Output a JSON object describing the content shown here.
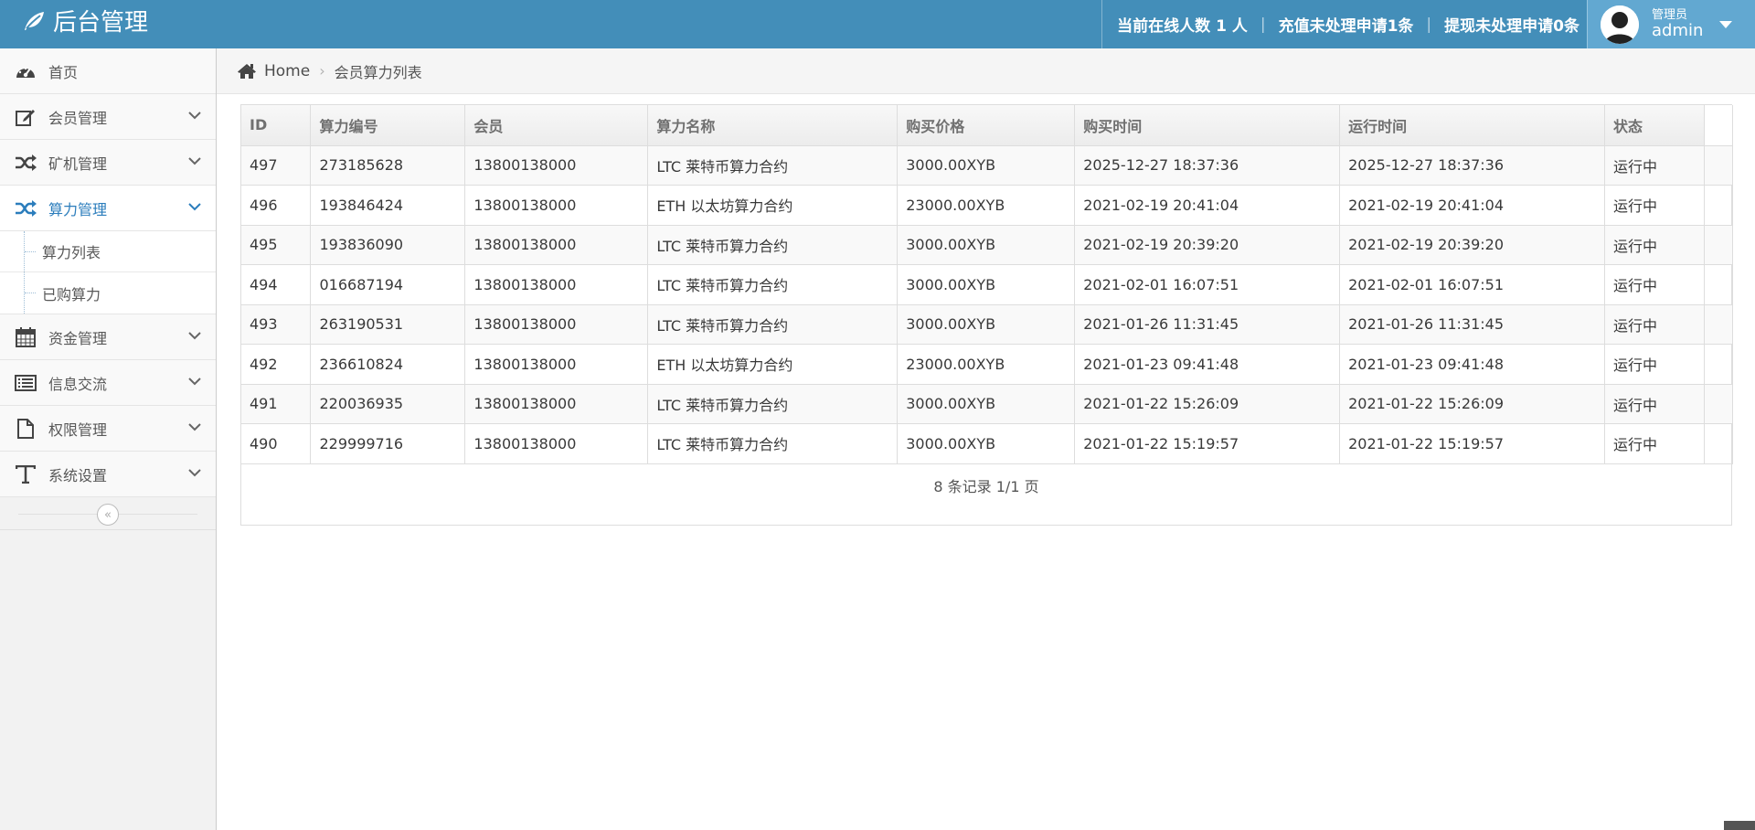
{
  "header": {
    "brand": "后台管理",
    "online_users": "当前在线人数 1 人",
    "recharge_pending": "充值未处理申请1条",
    "withdraw_pending": "提现未处理申请0条",
    "user_role": "管理员",
    "user_name": "admin"
  },
  "sidebar": {
    "items": [
      {
        "label": "首页"
      },
      {
        "label": "会员管理"
      },
      {
        "label": "矿机管理"
      },
      {
        "label": "算力管理"
      },
      {
        "label": "资金管理"
      },
      {
        "label": "信息交流"
      },
      {
        "label": "权限管理"
      },
      {
        "label": "系统设置"
      }
    ],
    "submenu": [
      {
        "label": "算力列表"
      },
      {
        "label": "已购算力"
      }
    ],
    "collapse_glyph": "«"
  },
  "breadcrumb": {
    "home": "Home",
    "current": "会员算力列表"
  },
  "table": {
    "headers": [
      "ID",
      "算力编号",
      "会员",
      "算力名称",
      "购买价格",
      "购买时间",
      "运行时间",
      "状态"
    ],
    "rows": [
      [
        "497",
        "273185628",
        "13800138000",
        "LTC 莱特币算力合约",
        "3000.00XYB",
        "2025-12-27 18:37:36",
        "2025-12-27 18:37:36",
        "运行中"
      ],
      [
        "496",
        "193846424",
        "13800138000",
        "ETH 以太坊算力合约",
        "23000.00XYB",
        "2021-02-19 20:41:04",
        "2021-02-19 20:41:04",
        "运行中"
      ],
      [
        "495",
        "193836090",
        "13800138000",
        "LTC 莱特币算力合约",
        "3000.00XYB",
        "2021-02-19 20:39:20",
        "2021-02-19 20:39:20",
        "运行中"
      ],
      [
        "494",
        "016687194",
        "13800138000",
        "LTC 莱特币算力合约",
        "3000.00XYB",
        "2021-02-01 16:07:51",
        "2021-02-01 16:07:51",
        "运行中"
      ],
      [
        "493",
        "263190531",
        "13800138000",
        "LTC 莱特币算力合约",
        "3000.00XYB",
        "2021-01-26 11:31:45",
        "2021-01-26 11:31:45",
        "运行中"
      ],
      [
        "492",
        "236610824",
        "13800138000",
        "ETH 以太坊算力合约",
        "23000.00XYB",
        "2021-01-23 09:41:48",
        "2021-01-23 09:41:48",
        "运行中"
      ],
      [
        "491",
        "220036935",
        "13800138000",
        "LTC 莱特币算力合约",
        "3000.00XYB",
        "2021-01-22 15:26:09",
        "2021-01-22 15:26:09",
        "运行中"
      ],
      [
        "490",
        "229999716",
        "13800138000",
        "LTC 莱特币算力合约",
        "3000.00XYB",
        "2021-01-22 15:19:57",
        "2021-01-22 15:19:57",
        "运行中"
      ]
    ],
    "pager": "8 条记录 1/1 页"
  },
  "colors": {
    "header_bg": "#438eb9",
    "user_bg": "#62a8d1",
    "active_menu": "#2b7dbc"
  }
}
